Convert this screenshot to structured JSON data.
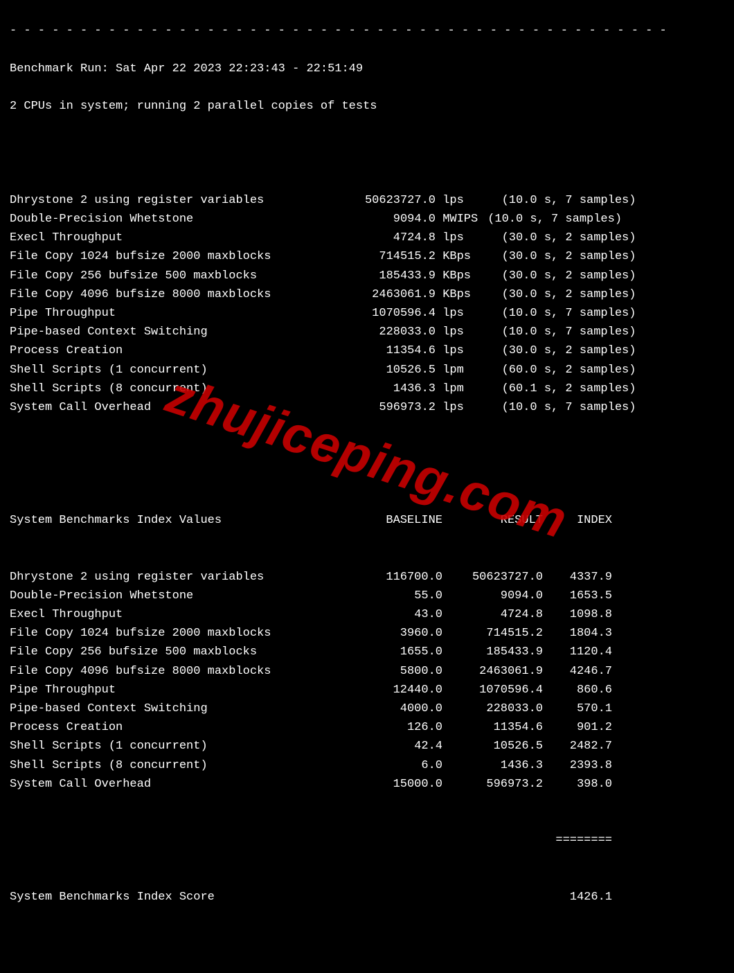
{
  "dashes": "- - - - - - - - - - - - - - - - - - - - - - - - - - - - - - - - - - - - - - - - - - - - - - -",
  "run_line": "Benchmark Run: Sat Apr 22 2023 22:23:43 - 22:51:49",
  "cpu_line": "2 CPUs in system; running 2 parallel copies of tests",
  "raw": [
    {
      "name": "Dhrystone 2 using register variables",
      "value": "50623727.0",
      "unit": "lps",
      "timing": "(10.0 s, 7 samples)"
    },
    {
      "name": "Double-Precision Whetstone",
      "value": "9094.0",
      "unit": "MWIPS",
      "timing": "(10.0 s, 7 samples)"
    },
    {
      "name": "Execl Throughput",
      "value": "4724.8",
      "unit": "lps",
      "timing": "(30.0 s, 2 samples)"
    },
    {
      "name": "File Copy 1024 bufsize 2000 maxblocks",
      "value": "714515.2",
      "unit": "KBps",
      "timing": "(30.0 s, 2 samples)"
    },
    {
      "name": "File Copy 256 bufsize 500 maxblocks",
      "value": "185433.9",
      "unit": "KBps",
      "timing": "(30.0 s, 2 samples)"
    },
    {
      "name": "File Copy 4096 bufsize 8000 maxblocks",
      "value": "2463061.9",
      "unit": "KBps",
      "timing": "(30.0 s, 2 samples)"
    },
    {
      "name": "Pipe Throughput",
      "value": "1070596.4",
      "unit": "lps",
      "timing": "(10.0 s, 7 samples)"
    },
    {
      "name": "Pipe-based Context Switching",
      "value": "228033.0",
      "unit": "lps",
      "timing": "(10.0 s, 7 samples)"
    },
    {
      "name": "Process Creation",
      "value": "11354.6",
      "unit": "lps",
      "timing": "(30.0 s, 2 samples)"
    },
    {
      "name": "Shell Scripts (1 concurrent)",
      "value": "10526.5",
      "unit": "lpm",
      "timing": "(60.0 s, 2 samples)"
    },
    {
      "name": "Shell Scripts (8 concurrent)",
      "value": "1436.3",
      "unit": "lpm",
      "timing": "(60.1 s, 2 samples)"
    },
    {
      "name": "System Call Overhead",
      "value": "596973.2",
      "unit": "lps",
      "timing": "(10.0 s, 7 samples)"
    }
  ],
  "index_header": {
    "title": "System Benchmarks Index Values",
    "baseline": "BASELINE",
    "result": "RESULT",
    "index": "INDEX"
  },
  "index": [
    {
      "name": "Dhrystone 2 using register variables",
      "baseline": "116700.0",
      "result": "50623727.0",
      "index": "4337.9"
    },
    {
      "name": "Double-Precision Whetstone",
      "baseline": "55.0",
      "result": "9094.0",
      "index": "1653.5"
    },
    {
      "name": "Execl Throughput",
      "baseline": "43.0",
      "result": "4724.8",
      "index": "1098.8"
    },
    {
      "name": "File Copy 1024 bufsize 2000 maxblocks",
      "baseline": "3960.0",
      "result": "714515.2",
      "index": "1804.3"
    },
    {
      "name": "File Copy 256 bufsize 500 maxblocks",
      "baseline": "1655.0",
      "result": "185433.9",
      "index": "1120.4"
    },
    {
      "name": "File Copy 4096 bufsize 8000 maxblocks",
      "baseline": "5800.0",
      "result": "2463061.9",
      "index": "4246.7"
    },
    {
      "name": "Pipe Throughput",
      "baseline": "12440.0",
      "result": "1070596.4",
      "index": "860.6"
    },
    {
      "name": "Pipe-based Context Switching",
      "baseline": "4000.0",
      "result": "228033.0",
      "index": "570.1"
    },
    {
      "name": "Process Creation",
      "baseline": "126.0",
      "result": "11354.6",
      "index": "901.2"
    },
    {
      "name": "Shell Scripts (1 concurrent)",
      "baseline": "42.4",
      "result": "10526.5",
      "index": "2482.7"
    },
    {
      "name": "Shell Scripts (8 concurrent)",
      "baseline": "6.0",
      "result": "1436.3",
      "index": "2393.8"
    },
    {
      "name": "System Call Overhead",
      "baseline": "15000.0",
      "result": "596973.2",
      "index": "398.0"
    }
  ],
  "rule": "========",
  "score_label": "System Benchmarks Index Score",
  "score_value": "1426.1",
  "watermark": "zhujiceping.com"
}
